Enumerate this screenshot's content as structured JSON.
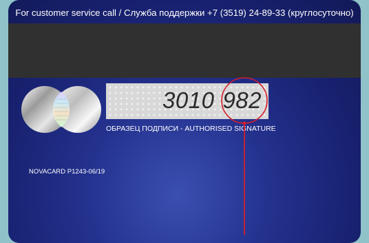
{
  "card": {
    "service_text": "For customer service call / Служба поддержки +7 (3519) 24-89-33 (круглосуточно)",
    "card_number_main": "3010",
    "card_number_cvv": "982",
    "signature_label": "ОБРАЗЕЦ ПОДПИСИ - AUTHORISED SIGNATURE",
    "card_code": "NOVACARD P1243-06/19"
  },
  "colors": {
    "background": "#8fc3c9",
    "card_blue": "#24328f",
    "mag_stripe": "#303030",
    "annotation_red": "#d61f2b"
  },
  "annotation": {
    "target": "cvv"
  }
}
